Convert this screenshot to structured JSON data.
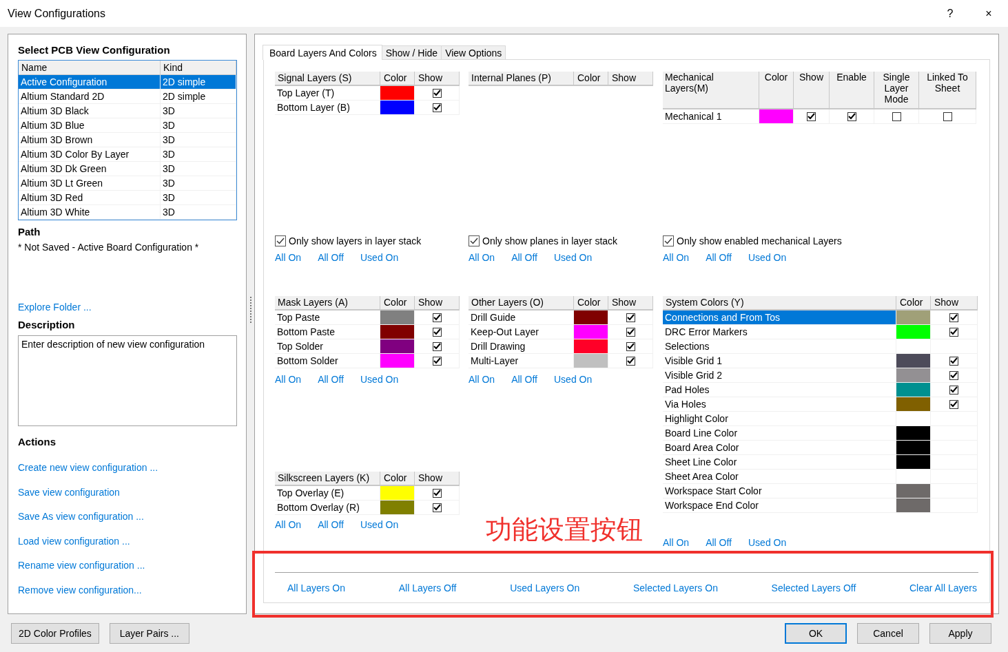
{
  "window": {
    "title": "View Configurations",
    "help": "?",
    "close": "×"
  },
  "left": {
    "heading": "Select PCB View Configuration",
    "list": {
      "columns": [
        "Name",
        "Kind"
      ],
      "rows": [
        {
          "name": "Active Configuration",
          "kind": "2D simple",
          "selected": true
        },
        {
          "name": "Altium Standard 2D",
          "kind": "2D simple",
          "selected": false
        },
        {
          "name": "Altium 3D Black",
          "kind": "3D",
          "selected": false
        },
        {
          "name": "Altium 3D Blue",
          "kind": "3D",
          "selected": false
        },
        {
          "name": "Altium 3D Brown",
          "kind": "3D",
          "selected": false
        },
        {
          "name": "Altium 3D Color By Layer",
          "kind": "3D",
          "selected": false
        },
        {
          "name": "Altium 3D Dk Green",
          "kind": "3D",
          "selected": false
        },
        {
          "name": "Altium 3D Lt Green",
          "kind": "3D",
          "selected": false
        },
        {
          "name": "Altium 3D Red",
          "kind": "3D",
          "selected": false
        },
        {
          "name": "Altium 3D White",
          "kind": "3D",
          "selected": false
        }
      ]
    },
    "path_heading": "Path",
    "path": "* Not Saved - Active Board Configuration *",
    "explore_link": "Explore Folder ...",
    "description_heading": "Description",
    "description": "Enter description of new view configuration",
    "actions_heading": "Actions",
    "actions": [
      "Create new view configuration ...",
      "Save view configuration",
      "Save As view configuration ...",
      "Load view configuration ...",
      "Rename view configuration ...",
      "Remove view configuration..."
    ]
  },
  "tabs": [
    {
      "label": "Board Layers And Colors",
      "selected": true
    },
    {
      "label": "Show / Hide",
      "selected": false
    },
    {
      "label": "View Options",
      "selected": false
    }
  ],
  "layer_columns": [
    {
      "groups": [
        {
          "table": {
            "columns": [
              "Signal Layers (S)",
              "Color",
              "Show"
            ],
            "rows": [
              {
                "name": "Top Layer (T)",
                "color": "#ff0000",
                "checks": [
                  true
                ]
              },
              {
                "name": "Bottom Layer (B)",
                "color": "#0000ff",
                "checks": [
                  true
                ]
              }
            ]
          },
          "filter": {
            "label": "Only show layers in layer stack",
            "checked": true
          },
          "links": [
            "All On",
            "All Off",
            "Used On"
          ]
        },
        {
          "table": {
            "columns": [
              "Mask Layers (A)",
              "Color",
              "Show"
            ],
            "rows": [
              {
                "name": "Top Paste",
                "color": "#808080",
                "checks": [
                  true
                ]
              },
              {
                "name": "Bottom Paste",
                "color": "#800000",
                "checks": [
                  true
                ]
              },
              {
                "name": "Top Solder",
                "color": "#800080",
                "checks": [
                  true
                ]
              },
              {
                "name": "Bottom Solder",
                "color": "#ff00ff",
                "checks": [
                  true
                ]
              }
            ]
          },
          "links": [
            "All On",
            "All Off",
            "Used On"
          ]
        },
        {
          "table": {
            "columns": [
              "Silkscreen Layers (K)",
              "Color",
              "Show"
            ],
            "rows": [
              {
                "name": "Top Overlay (E)",
                "color": "#ffff00",
                "checks": [
                  true
                ]
              },
              {
                "name": "Bottom Overlay (R)",
                "color": "#808000",
                "checks": [
                  true
                ]
              }
            ]
          },
          "links": [
            "All On",
            "All Off",
            "Used On"
          ]
        }
      ]
    },
    {
      "groups": [
        {
          "table": {
            "columns": [
              "Internal Planes (P)",
              "Color",
              "Show"
            ]
          },
          "filter": {
            "label": "Only show planes in layer stack",
            "checked": true
          },
          "links": [
            "All On",
            "All Off",
            "Used On"
          ]
        },
        {
          "table": {
            "columns": [
              "Other Layers (O)",
              "Color",
              "Show"
            ],
            "rows": [
              {
                "name": "Drill Guide",
                "color": "#800000",
                "checks": [
                  true
                ]
              },
              {
                "name": "Keep-Out Layer",
                "color": "#ff00ff",
                "checks": [
                  true
                ]
              },
              {
                "name": "Drill Drawing",
                "color": "#ff0028",
                "checks": [
                  true
                ]
              },
              {
                "name": "Multi-Layer",
                "color": "#c0c0c0",
                "checks": [
                  true
                ]
              }
            ]
          },
          "links": [
            "All On",
            "All Off",
            "Used On"
          ]
        }
      ]
    },
    {
      "groups": [
        {
          "table": {
            "columns": [
              "Mechanical Layers(M)",
              "Color",
              "Show",
              "Enable",
              "Single Layer Mode",
              "Linked To Sheet"
            ],
            "rows": [
              {
                "name": "Mechanical 1",
                "color": "#ff00ff",
                "checks": [
                  true,
                  true,
                  false,
                  false
                ]
              }
            ]
          },
          "filter": {
            "label": "Only show enabled mechanical Layers",
            "checked": true
          },
          "links": [
            "All On",
            "All Off",
            "Used On"
          ]
        },
        {
          "table": {
            "columns": [
              "System Colors (Y)",
              "Color",
              "Show"
            ],
            "rows": [
              {
                "name": "Connections and From Tos",
                "color": "#a0a078",
                "checks": [
                  true
                ],
                "selected": true
              },
              {
                "name": "DRC Error Markers",
                "color": "#00ff00",
                "checks": [
                  true
                ],
                "selected": false
              },
              {
                "name": "Selections",
                "selected": false
              },
              {
                "name": "Visible Grid 1",
                "color": "#4d4b5a",
                "checks": [
                  true
                ],
                "selected": false
              },
              {
                "name": "Visible Grid 2",
                "color": "#939093",
                "checks": [
                  true
                ],
                "selected": false
              },
              {
                "name": "Pad Holes",
                "color": "#009090",
                "checks": [
                  true
                ],
                "selected": false
              },
              {
                "name": "Via Holes",
                "color": "#806000",
                "checks": [
                  true
                ],
                "selected": false
              },
              {
                "name": "Highlight Color",
                "selected": false
              },
              {
                "name": "Board Line Color",
                "color": "#000000",
                "selected": false
              },
              {
                "name": "Board Area Color",
                "color": "#000000",
                "selected": false
              },
              {
                "name": "Sheet Line Color",
                "color": "#000000",
                "selected": false
              },
              {
                "name": "Sheet Area Color",
                "selected": false
              },
              {
                "name": "Workspace Start Color",
                "color": "#6e6a69",
                "selected": false
              },
              {
                "name": "Workspace End Color",
                "color": "#6e6a69",
                "selected": false
              }
            ]
          },
          "links": [
            "All On",
            "All Off",
            "Used On"
          ]
        }
      ]
    }
  ],
  "layer_actions": [
    "All Layers On",
    "All Layers Off",
    "Used Layers On",
    "Selected Layers On",
    "Selected Layers Off",
    "Clear All Layers"
  ],
  "annotation": {
    "text": "功能设置按钮"
  },
  "buttons_left": [
    "2D Color Profiles",
    "Layer Pairs ..."
  ],
  "buttons_right": [
    {
      "label": "OK",
      "focused": true
    },
    {
      "label": "Cancel",
      "focused": false
    },
    {
      "label": "Apply",
      "focused": false
    }
  ]
}
